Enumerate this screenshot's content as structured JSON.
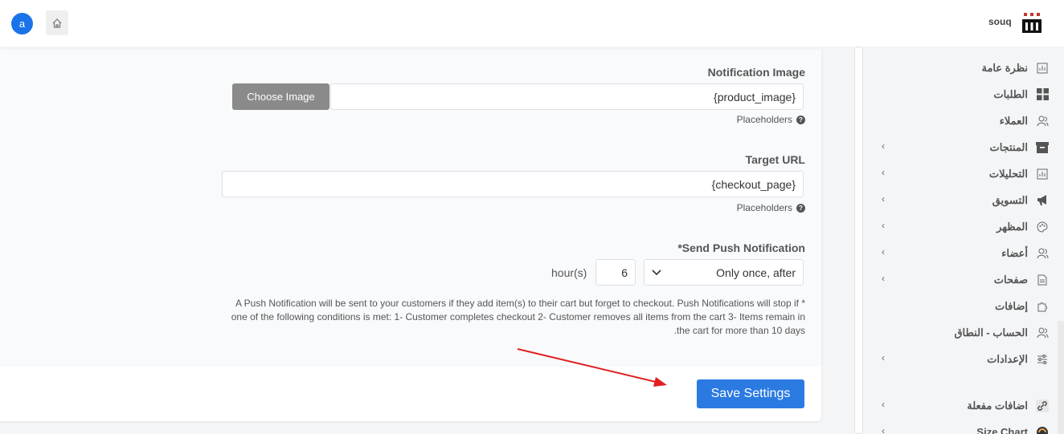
{
  "header": {
    "avatar_letter": "a",
    "home_icon": "home-icon",
    "brand_name": "souq",
    "brand_logo": "souq-logo"
  },
  "form": {
    "notification_image": {
      "label": "Notification Image",
      "value": "{product_image}",
      "button": "Choose Image",
      "helper": "Placeholders"
    },
    "target_url": {
      "label": "Target URL",
      "value": "{checkout_page}",
      "helper": "Placeholders"
    },
    "send_push": {
      "label": "*Send Push Notification",
      "select_value": "Only once, after",
      "number_value": "6",
      "unit": "hour(s)"
    },
    "note": "* A Push Notification will be sent to your customers if they add item(s) to their cart but forget to checkout. Push Notifications will stop if one of the following conditions is met: 1- Customer completes checkout 2- Customer removes all items from the cart 3- Items remain in the cart for more than 10 days.",
    "save_label": "Save Settings"
  },
  "sidebar": {
    "items": [
      {
        "label": "نظرة عامة",
        "icon": "overview-chart-icon",
        "has_children": false
      },
      {
        "label": "الطلبات",
        "icon": "orders-grid-icon",
        "has_children": false
      },
      {
        "label": "العملاء",
        "icon": "customers-icon",
        "has_children": false
      },
      {
        "label": "المنتجات",
        "icon": "products-box-icon",
        "has_children": true
      },
      {
        "label": "التحليلات",
        "icon": "analytics-chart-icon",
        "has_children": true
      },
      {
        "label": "التسويق",
        "icon": "megaphone-icon",
        "has_children": true
      },
      {
        "label": "المظهر",
        "icon": "palette-icon",
        "has_children": true
      },
      {
        "label": "أعضاء",
        "icon": "members-icon",
        "has_children": true
      },
      {
        "label": "صفحات",
        "icon": "page-icon",
        "has_children": true
      },
      {
        "label": "إضافات",
        "icon": "puzzle-icon",
        "has_children": false
      },
      {
        "label": "الحساب - النطاق",
        "icon": "account-icon",
        "has_children": false
      },
      {
        "label": "الإعدادات",
        "icon": "settings-sliders-icon",
        "has_children": true
      },
      {
        "label": "اضافات مفعلة",
        "icon": "link-icon",
        "has_children": true
      },
      {
        "label": "Size Chart",
        "icon": "size-chart-icon",
        "has_children": true
      }
    ]
  },
  "colors": {
    "primary": "#2a7ae2",
    "avatar": "#1a73e8",
    "arrow": "#e02020"
  }
}
